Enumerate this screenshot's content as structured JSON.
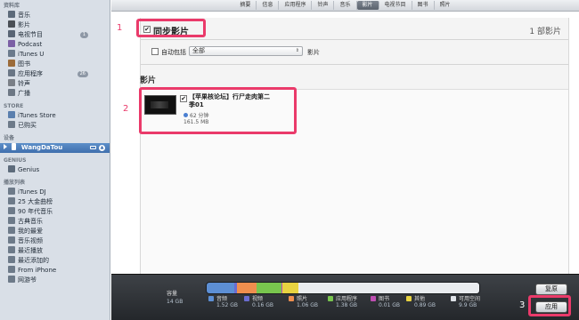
{
  "sidebar": {
    "library_header": "资料库",
    "library": [
      {
        "label": "音乐",
        "icon": "music-note-icon",
        "color": "#5c6a7a"
      },
      {
        "label": "影片",
        "icon": "film-icon",
        "color": "#4a4f56"
      },
      {
        "label": "电视节目",
        "icon": "tv-icon",
        "color": "#596575",
        "count": "1"
      },
      {
        "label": "Podcast",
        "icon": "podcast-icon",
        "color": "#7b5fa5"
      },
      {
        "label": "iTunes U",
        "icon": "graduation-cap-icon",
        "color": "#6b7a8c"
      },
      {
        "label": "图书",
        "icon": "book-icon",
        "color": "#9b6b3a"
      },
      {
        "label": "应用程序",
        "icon": "apps-icon",
        "color": "#6a7685",
        "count": "26"
      },
      {
        "label": "铃声",
        "icon": "bell-icon",
        "color": "#7a7f87"
      },
      {
        "label": "广播",
        "icon": "radio-icon",
        "color": "#6d7784"
      }
    ],
    "store_header": "STORE",
    "store": [
      {
        "label": "iTunes Store",
        "icon": "store-icon",
        "color": "#5a7fae"
      },
      {
        "label": "已购买",
        "icon": "purchased-icon",
        "color": "#6d7a89"
      }
    ],
    "devices_header": "设备",
    "device": {
      "label": "WangDaTou",
      "icon": "iphone-icon",
      "color": "#ffffff"
    },
    "genius_header": "GENIUS",
    "genius": [
      {
        "label": "Genius",
        "icon": "genius-atom-icon",
        "color": "#5d6b7b"
      }
    ],
    "playlists_header": "播放列表",
    "playlists": [
      {
        "label": "iTunes DJ",
        "icon": "dj-icon",
        "color": "#6d7a89"
      },
      {
        "label": "25 大金曲榜",
        "icon": "gear-playlist-icon",
        "color": "#6d7a89"
      },
      {
        "label": "90 年代音乐",
        "icon": "gear-playlist-icon",
        "color": "#6d7a89"
      },
      {
        "label": "古典音乐",
        "icon": "gear-playlist-icon",
        "color": "#6d7a89"
      },
      {
        "label": "我的最爱",
        "icon": "gear-playlist-icon",
        "color": "#6d7a89"
      },
      {
        "label": "音乐视频",
        "icon": "gear-playlist-icon",
        "color": "#6d7a89"
      },
      {
        "label": "最近播放",
        "icon": "gear-playlist-icon",
        "color": "#6d7a89"
      },
      {
        "label": "最近添加的",
        "icon": "gear-playlist-icon",
        "color": "#6d7a89"
      },
      {
        "label": "From iPhone",
        "icon": "playlist-icon",
        "color": "#6d7a89"
      },
      {
        "label": "网游爷",
        "icon": "playlist-icon",
        "color": "#6d7a89"
      }
    ]
  },
  "tabs": [
    {
      "label": "摘要"
    },
    {
      "label": "信息"
    },
    {
      "label": "应用程序"
    },
    {
      "label": "铃声"
    },
    {
      "label": "音乐"
    },
    {
      "label": "影片",
      "active": true
    },
    {
      "label": "电视节目"
    },
    {
      "label": "图书"
    },
    {
      "label": "照片"
    }
  ],
  "movies": {
    "sync_label": "同步影片",
    "sync_checked": "✔",
    "count_label": "1 部影片",
    "auto_include_label": "自动包括",
    "auto_select_value": "全部",
    "auto_suffix": "影片",
    "section_title": "影片",
    "item": {
      "title_line1": "【苹果核论坛】行尸走肉第二",
      "title_line2": "季01",
      "checked": "✔",
      "duration": "62 分钟",
      "size": "161.5 MB"
    }
  },
  "annotations": {
    "one": "1",
    "two": "2",
    "three": "3"
  },
  "capacity": {
    "label": "容量",
    "total": "14 GB",
    "segments": [
      {
        "name": "音频",
        "value_gb": 1.52,
        "color": "#5d8fd4"
      },
      {
        "name": "视频",
        "value_gb": 0.16,
        "color": "#6a6cd0"
      },
      {
        "name": "照片",
        "value_gb": 1.06,
        "color": "#ef8f4e"
      },
      {
        "name": "应用程序",
        "value_gb": 1.38,
        "color": "#79c64e"
      },
      {
        "name": "图书",
        "value_gb": 0.01,
        "color": "#c04fb3"
      },
      {
        "name": "其他",
        "value_gb": 0.89,
        "color": "#e8d341"
      },
      {
        "name": "可用空间",
        "value_gb": 9.9,
        "color": "#e9ecef"
      }
    ],
    "legend": [
      {
        "name": "音频",
        "value": "1.52 GB",
        "color": "#5d8fd4"
      },
      {
        "name": "视频",
        "value": "0.16 GB",
        "color": "#6a6cd0"
      },
      {
        "name": "照片",
        "value": "1.06 GB",
        "color": "#ef8f4e"
      },
      {
        "name": "应用程序",
        "value": "1.38 GB",
        "color": "#79c64e"
      },
      {
        "name": "图书",
        "value": "0.01 GB",
        "color": "#c04fb3"
      },
      {
        "name": "其他",
        "value": "0.89 GB",
        "color": "#e8d341"
      },
      {
        "name": "可用空间",
        "value": "9.9 GB",
        "color": "#dfe3e8"
      }
    ]
  },
  "buttons": {
    "revert": "复原",
    "apply": "应用"
  },
  "colors": {
    "accent": "#3f6fad",
    "highlight": "#ea3a6a"
  }
}
